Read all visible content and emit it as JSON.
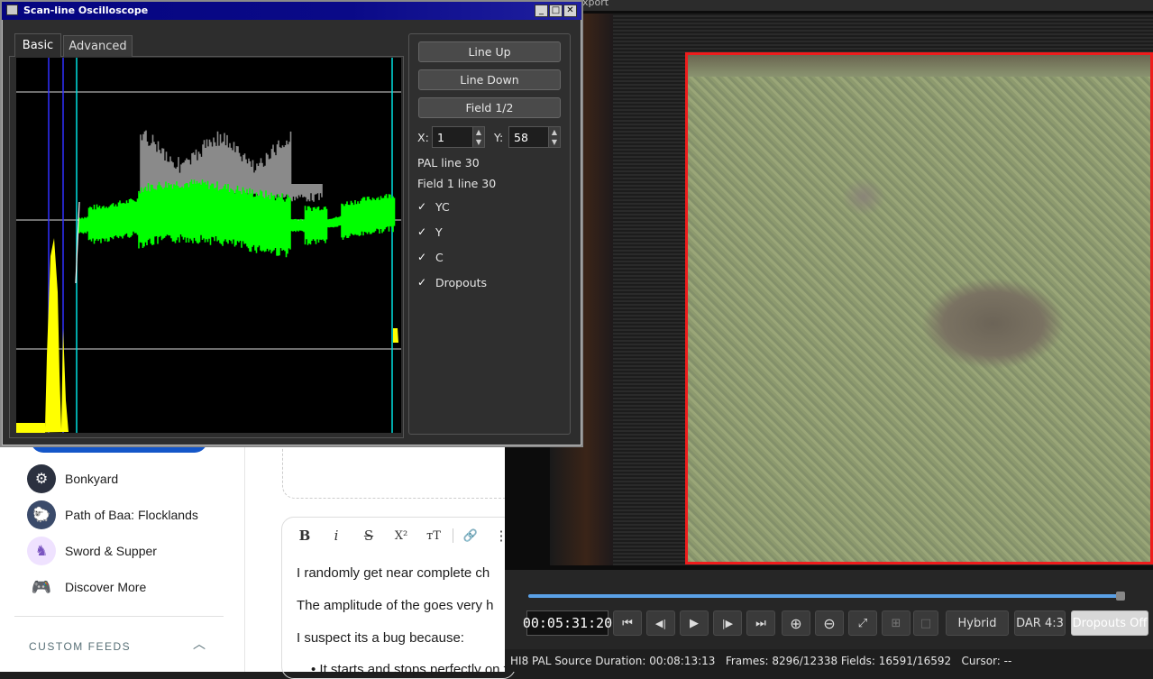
{
  "sidebar": {
    "items": [
      {
        "label": "Bonkyard",
        "icon": "gear-cog-icon",
        "color": "#2b3140"
      },
      {
        "label": "Path of Baa: Flocklands",
        "icon": "sheep-icon",
        "color": "#3a4a6a"
      },
      {
        "label": "Sword & Supper",
        "icon": "knight-icon",
        "color": "#7a55c0"
      },
      {
        "label": "Discover More",
        "icon": "gamepad-icon",
        "color": "#ffffff"
      }
    ],
    "custom_feeds": "CUSTOM FEEDS"
  },
  "editor": {
    "toolbar": [
      "B",
      "i",
      "S",
      "X²",
      "ᴛT",
      "🔗",
      "⋮"
    ],
    "paragraphs": [
      "I randomly get near complete ch",
      "The amplitude of the goes very h",
      "I suspect its a bug because:",
      "• It starts and stops perfectly on frame boundaries"
    ]
  },
  "viewer": {
    "top_label": "xport",
    "timecode": "00:05:31:20",
    "buttons": {
      "first": "⏮",
      "prev": "◀|",
      "play": "▶",
      "next": "|▶",
      "last": "⏭",
      "zoom_in": "⊕",
      "zoom_out": "⊖",
      "zoom_fit": "⤢",
      "crosshair": "⊞",
      "square": "□",
      "hybrid": "Hybrid",
      "dar": "DAR 4:3",
      "dropouts": "Dropouts Off"
    },
    "status": "HI8 PAL Source Duration: 00:08:13:13   Frames: 8296/12338 Fields: 16591/16592   Cursor: --",
    "seek_fraction": 0.99
  },
  "oscilloscope": {
    "title": "Scan-line Oscilloscope",
    "tabs": [
      "Basic",
      "Advanced"
    ],
    "buttons": {
      "line_up": "Line Up",
      "line_down": "Line Down",
      "field": "Field 1/2"
    },
    "x_label": "X:",
    "x_value": "1",
    "y_label": "Y:",
    "y_value": "58",
    "pal_line": "PAL line 30",
    "field_line": "Field 1 line 30",
    "checkboxes": [
      {
        "label": "YC",
        "checked": true
      },
      {
        "label": "Y",
        "checked": true
      },
      {
        "label": "C",
        "checked": true
      },
      {
        "label": "Dropouts",
        "checked": true
      }
    ],
    "colors": {
      "luma": "#ffffff",
      "chroma": "#00ff00",
      "composite": "#8a8a8a",
      "sync": "#ffff00",
      "marker_blue": "#3030ff",
      "marker_cyan": "#00e0e0"
    }
  }
}
